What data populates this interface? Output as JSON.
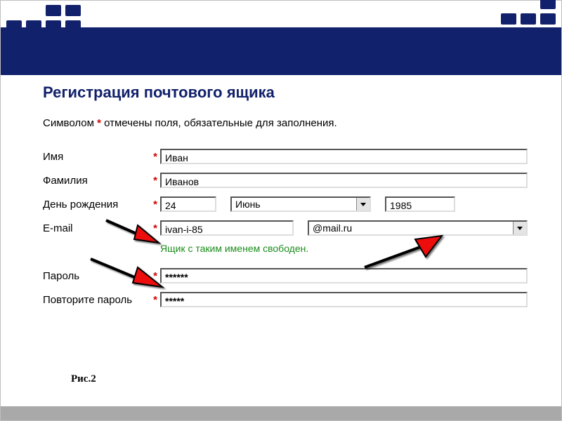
{
  "title": "Регистрация почтового ящика",
  "required_note_pre": "Символом ",
  "required_note_post": " отмечены поля, обязательные для заполнения.",
  "labels": {
    "first_name": "Имя",
    "last_name": "Фамилия",
    "birthday": "День рождения",
    "email": "E-mail",
    "password": "Пароль",
    "password2": "Повторите пароль"
  },
  "values": {
    "first_name": "Иван",
    "last_name": "Иванов",
    "birth_day": "24",
    "birth_month": "Июнь",
    "birth_year": "1985",
    "email_local": "ivan-i-85",
    "email_domain": "@mail.ru",
    "password": "******",
    "password2": "*****"
  },
  "messages": {
    "mailbox_free": "Ящик с таким именем свободен."
  },
  "asterisk": "*",
  "caption": "Рис.2"
}
